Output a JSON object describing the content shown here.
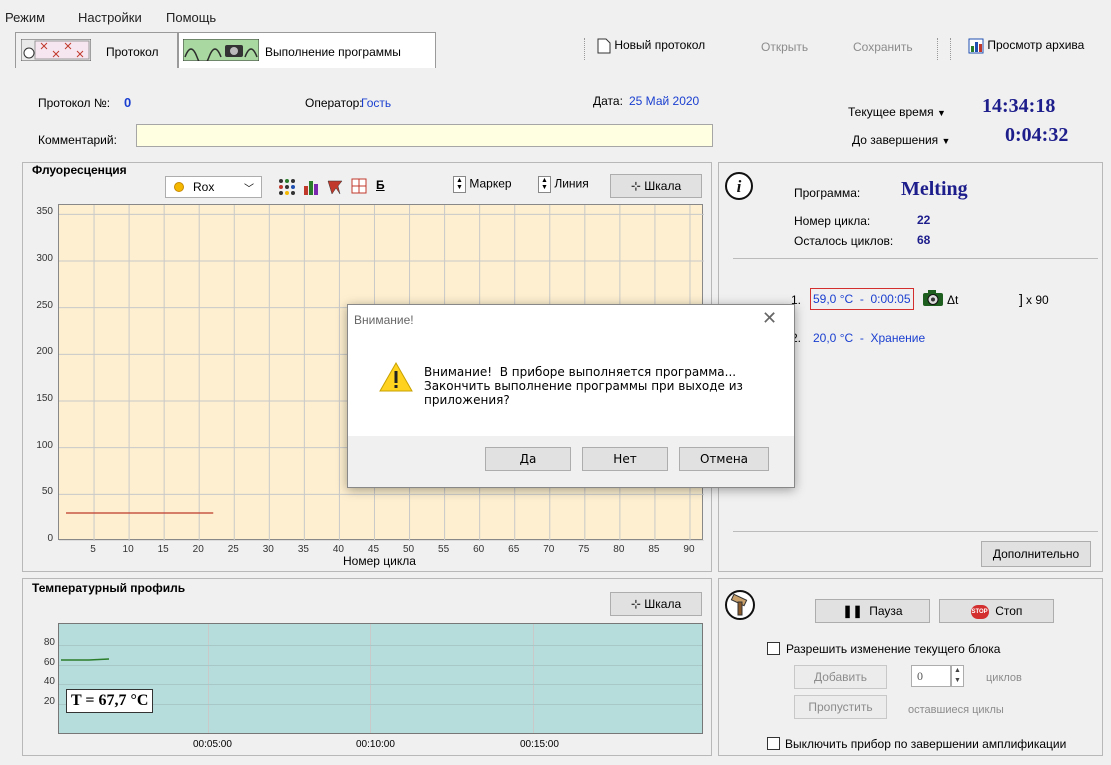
{
  "menu": {
    "items": [
      "Режим",
      "Настройки",
      "Помощь"
    ]
  },
  "tabs": {
    "protocol": "Протокол",
    "execution": "Выполнение программы"
  },
  "toolbar": {
    "new_protocol": "Новый протокол",
    "open": "Открыть",
    "save": "Сохранить",
    "archive": "Просмотр архива"
  },
  "header": {
    "protocol_no_label": "Протокол №:",
    "protocol_no": "0",
    "operator_label": "Оператор:",
    "operator": "Гость",
    "date_label": "Дата:",
    "date": "25 Май 2020",
    "comment_label": "Комментарий:",
    "comment": "",
    "current_time_label": "Текущее время",
    "current_time": "14:34:18",
    "until_end_label": "До завершения",
    "until_end": "0:04:32"
  },
  "fluor": {
    "title": "Флуоресценция",
    "channel": "Rox",
    "bold_btn": "Б",
    "marker": "Маркер",
    "line": "Линия",
    "scale": "Шкала",
    "xlabel": "Номер цикла"
  },
  "chart_data": {
    "type": "line",
    "xlabel": "Номер цикла",
    "ylabel": "",
    "xlim": [
      0,
      92
    ],
    "ylim": [
      0,
      360
    ],
    "x_ticks": [
      5,
      10,
      15,
      20,
      25,
      30,
      35,
      40,
      45,
      50,
      55,
      60,
      65,
      70,
      75,
      80,
      85,
      90
    ],
    "y_ticks": [
      0,
      50,
      100,
      150,
      200,
      250,
      300,
      350
    ],
    "series": [
      {
        "color": "#c0392b",
        "x": [
          1,
          22
        ],
        "y": [
          30,
          30
        ]
      }
    ]
  },
  "temp": {
    "title": "Температурный профиль",
    "scale": "Шкала",
    "y_ticks": [
      "80",
      "60",
      "40",
      "20"
    ],
    "x_ticks": [
      "00:05:00",
      "00:10:00",
      "00:15:00"
    ],
    "readout": "T = 67,7 °C"
  },
  "program": {
    "program_label": "Программа:",
    "program_name": "Melting",
    "cycle_label": "Номер цикла:",
    "cycle": "22",
    "remaining_label": "Осталось циклов:",
    "remaining": "68",
    "step1_no": "1.",
    "step1": "59,0 °C  -  0:00:05",
    "delta": "Δt",
    "repeat": "x 90",
    "step2_no": "2.",
    "step2": "20,0 °C  -  Хранение",
    "extra_btn": "Дополнительно"
  },
  "control": {
    "pause": "Пауза",
    "stop": "Стоп",
    "stop_icon": "STOP",
    "allow_change": "Разрешить изменение текущего блока",
    "add": "Добавить",
    "add_value": "0",
    "cycles": "циклов",
    "skip": "Пропустить",
    "remaining_cycles": "оставшиеся циклы",
    "power_off": "Выключить прибор по завершении амплификации"
  },
  "dialog": {
    "title": "Внимание!",
    "message1": "Внимание!  В приборе выполняется программа...",
    "message2": "Закончить выполнение программы при выходе из",
    "message3": "приложения?",
    "yes": "Да",
    "no": "Нет",
    "cancel": "Отмена"
  },
  "colors": {
    "chart_bg": "#fdefcf",
    "temp_bg": "#b7dcdc",
    "accent": "#1a3fd0"
  }
}
